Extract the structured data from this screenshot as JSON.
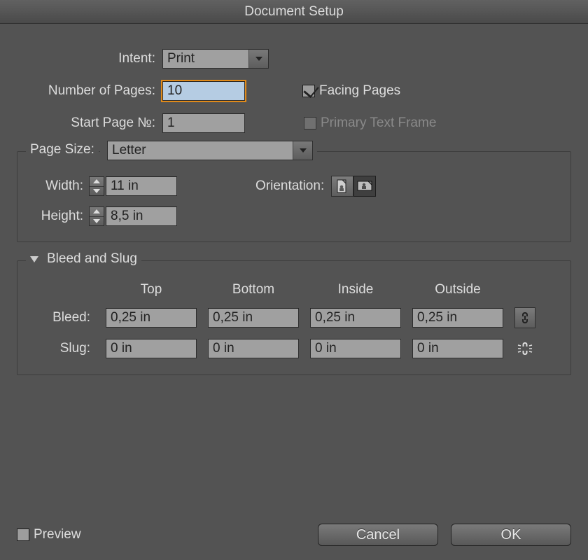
{
  "window": {
    "title": "Document Setup"
  },
  "intent": {
    "label": "Intent:",
    "value": "Print"
  },
  "pages": {
    "numLabel": "Number of Pages:",
    "numValue": "10",
    "startLabel": "Start Page №:",
    "startValue": "1",
    "facingLabel": "Facing Pages",
    "facingChecked": true,
    "primaryLabel": "Primary Text Frame",
    "primaryChecked": false,
    "primaryEnabled": false
  },
  "pageSize": {
    "label": "Page Size:",
    "preset": "Letter",
    "widthLabel": "Width:",
    "widthValue": "11 in",
    "heightLabel": "Height:",
    "heightValue": "8,5 in",
    "orientationLabel": "Orientation:"
  },
  "bleedSlug": {
    "sectionLabel": "Bleed and Slug",
    "headers": {
      "top": "Top",
      "bottom": "Bottom",
      "inside": "Inside",
      "outside": "Outside"
    },
    "bleed": {
      "label": "Bleed:",
      "top": "0,25 in",
      "bottom": "0,25 in",
      "inside": "0,25 in",
      "outside": "0,25 in",
      "linked": true
    },
    "slug": {
      "label": "Slug:",
      "top": "0 in",
      "bottom": "0 in",
      "inside": "0 in",
      "outside": "0 in",
      "linked": false
    }
  },
  "footer": {
    "previewLabel": "Preview",
    "previewChecked": false,
    "cancel": "Cancel",
    "ok": "OK"
  }
}
